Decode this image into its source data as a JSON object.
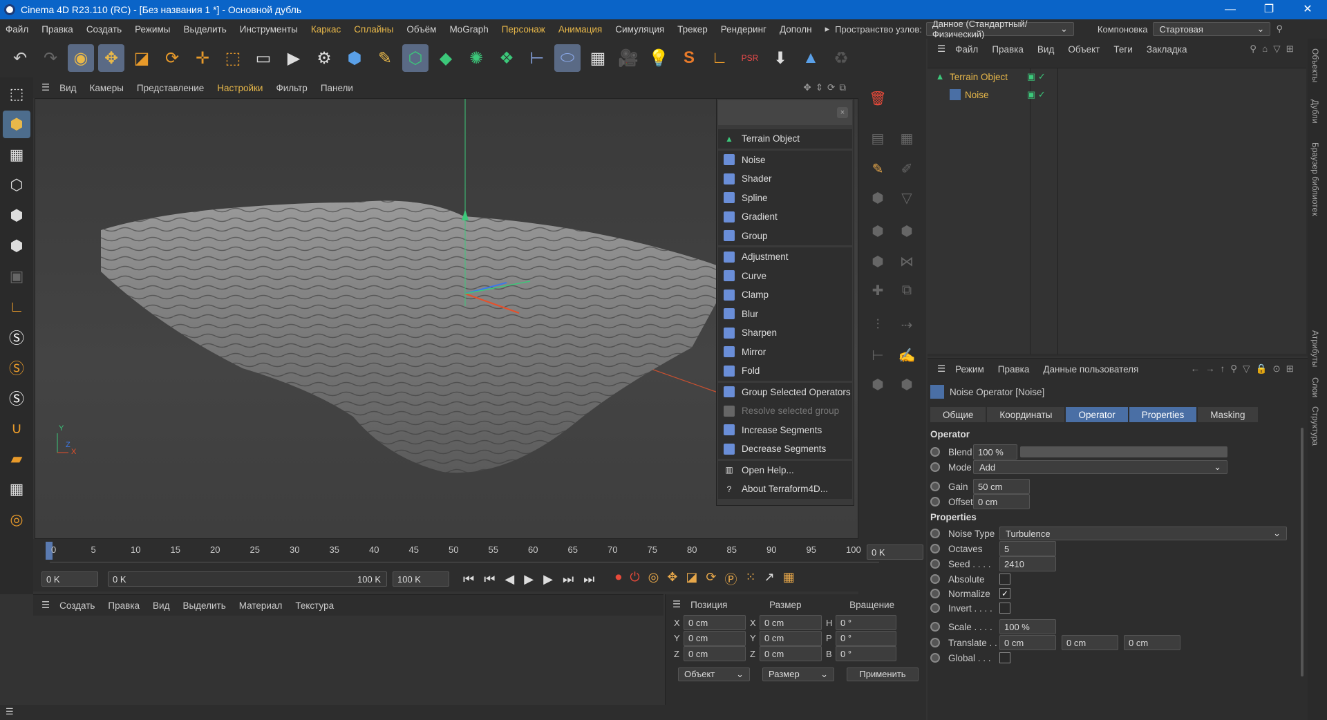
{
  "window": {
    "title": "Cinema 4D R23.110 (RC) - [Без названия 1 *] - Основной дубль",
    "min": "—",
    "max": "❐",
    "close": "✕"
  },
  "menubar": {
    "items": [
      "Файл",
      "Правка",
      "Создать",
      "Режимы",
      "Выделить",
      "Инструменты",
      "Каркас",
      "Сплайны",
      "Объём",
      "MoGraph",
      "Персонаж",
      "Анимация",
      "Симуляция",
      "Трекер",
      "Рендеринг",
      "Дополн"
    ],
    "arrow": "▸",
    "node_space_label": "Пространство узлов:",
    "node_space_value": "Данное (Стандартный/Физический)",
    "layout_label": "Компоновка",
    "layout_value": "Стартовая"
  },
  "viewport_menu": {
    "items": [
      "Вид",
      "Камеры",
      "Представление",
      "Настройки",
      "Фильтр",
      "Панели"
    ]
  },
  "popup": {
    "close": "×",
    "items": [
      {
        "label": "Terrain Object",
        "icon": "terrain-icon",
        "color": "#3cc87a"
      },
      {
        "sep": true
      },
      {
        "label": "Noise",
        "icon": "noise-icon",
        "color": "#6a8ed8"
      },
      {
        "label": "Shader",
        "icon": "shader-icon",
        "color": "#6a8ed8"
      },
      {
        "label": "Spline",
        "icon": "spline-icon",
        "color": "#6a8ed8"
      },
      {
        "label": "Gradient",
        "icon": "gradient-icon",
        "color": "#6a8ed8"
      },
      {
        "label": "Group",
        "icon": "group-icon",
        "color": "#6a8ed8"
      },
      {
        "sep": true
      },
      {
        "label": "Adjustment",
        "icon": "adjustment-icon",
        "color": "#6a8ed8"
      },
      {
        "label": "Curve",
        "icon": "curve-icon",
        "color": "#6a8ed8"
      },
      {
        "label": "Clamp",
        "icon": "clamp-icon",
        "color": "#6a8ed8"
      },
      {
        "label": "Blur",
        "icon": "blur-icon",
        "color": "#6a8ed8"
      },
      {
        "label": "Sharpen",
        "icon": "sharpen-icon",
        "color": "#6a8ed8"
      },
      {
        "label": "Mirror",
        "icon": "mirror-icon",
        "color": "#6a8ed8"
      },
      {
        "label": "Fold",
        "icon": "fold-icon",
        "color": "#6a8ed8"
      },
      {
        "sep": true
      },
      {
        "label": "Group Selected Operators",
        "icon": "group-selected-icon",
        "color": "#6a8ed8"
      },
      {
        "label": "Resolve selected group",
        "icon": "resolve-group-icon",
        "color": "#666",
        "dim": true
      },
      {
        "label": "Increase Segments",
        "icon": "increase-segments-icon",
        "color": "#6a8ed8"
      },
      {
        "label": "Decrease Segments",
        "icon": "decrease-segments-icon",
        "color": "#6a8ed8"
      },
      {
        "sep": true
      },
      {
        "label": "Open Help...",
        "icon": "help-book-icon",
        "color": "#ddd"
      },
      {
        "label": "About Terraform4D...",
        "icon": "question-icon",
        "color": "#ddd"
      }
    ]
  },
  "timeline": {
    "ticks": [
      "0",
      "5",
      "10",
      "15",
      "20",
      "25",
      "30",
      "35",
      "40",
      "45",
      "50",
      "55",
      "60",
      "65",
      "70",
      "75",
      "80",
      "85",
      "90",
      "95",
      "100"
    ],
    "current_frame": "0 K"
  },
  "transport": {
    "start": "0 K",
    "range_start": "0 K",
    "range_end": "100 K",
    "end": "100 K"
  },
  "material_menu": {
    "items": [
      "Создать",
      "Правка",
      "Вид",
      "Выделить",
      "Материал",
      "Текстура"
    ]
  },
  "coords": {
    "headers": [
      "Позиция",
      "Размер",
      "Вращение"
    ],
    "rows": [
      {
        "a": "X",
        "av": "0 cm",
        "b": "X",
        "bv": "0 cm",
        "c": "H",
        "cv": "0 °"
      },
      {
        "a": "Y",
        "av": "0 cm",
        "b": "Y",
        "bv": "0 cm",
        "c": "P",
        "cv": "0 °"
      },
      {
        "a": "Z",
        "av": "0 cm",
        "b": "Z",
        "bv": "0 cm",
        "c": "B",
        "cv": "0 °"
      }
    ],
    "mode1": "Объект",
    "mode2": "Размер",
    "apply": "Применить"
  },
  "object_manager": {
    "menu": [
      "Файл",
      "Правка",
      "Вид",
      "Объект",
      "Теги",
      "Закладка"
    ],
    "objects": [
      {
        "name": "Terrain Object",
        "color": "#e8b84a"
      },
      {
        "name": "Noise",
        "color": "#e8b84a"
      }
    ]
  },
  "vertical_tabs": [
    "Объекты",
    "Дубли",
    "Браузер библиотек",
    "Атрибуты",
    "Слои",
    "Структура"
  ],
  "attributes": {
    "menu": [
      "Режим",
      "Правка",
      "Данные пользователя"
    ],
    "object_title": "Noise Operator [Noise]",
    "tabs": [
      {
        "label": "Общие",
        "on": false
      },
      {
        "label": "Координаты",
        "on": false
      },
      {
        "label": "Operator",
        "on": true
      },
      {
        "label": "Properties",
        "on": true
      },
      {
        "label": "Masking",
        "on": false
      }
    ],
    "operator_section": "Operator",
    "blend_label": "Blend",
    "blend_value": "100 %",
    "mode_label": "Mode",
    "mode_value": "Add",
    "gain_label": "Gain",
    "gain_value": "50 cm",
    "offset_label": "Offset",
    "offset_value": "0 cm",
    "properties_section": "Properties",
    "noise_type_label": "Noise Type",
    "noise_type_value": "Turbulence",
    "octaves_label": "Octaves",
    "octaves_value": "5",
    "seed_label": "Seed . . . .",
    "seed_value": "2410",
    "absolute_label": "Absolute",
    "normalize_label": "Normalize",
    "invert_label": "Invert . . . .",
    "scale_label": "Scale . . . .",
    "scale_value": "100 %",
    "translate_label": "Translate . .",
    "translate_x": "0 cm",
    "translate_y": "0 cm",
    "translate_z": "0 cm",
    "global_label": "Global . . ."
  }
}
